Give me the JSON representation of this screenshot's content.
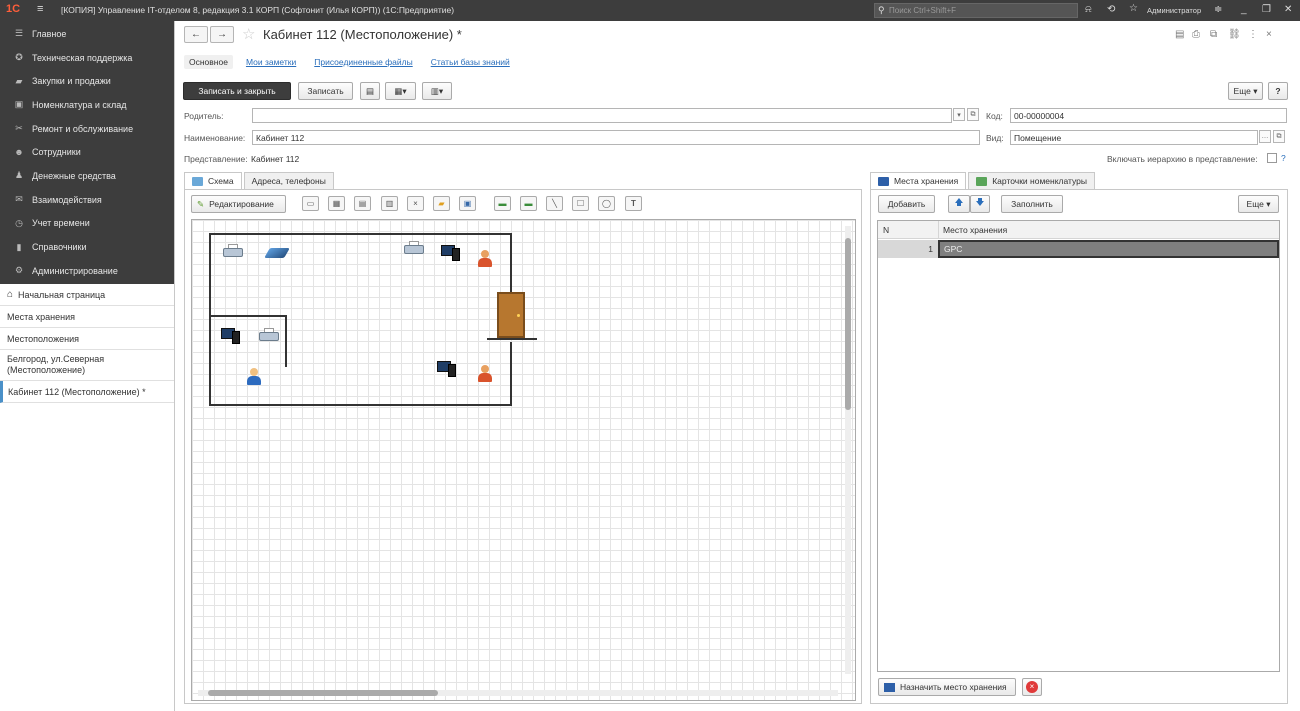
{
  "titlebar": {
    "logo": "1С",
    "title": "[КОПИЯ] Управление IT-отделом 8, редакция 3.1 КОРП (Софтонит (Илья КОРП))  (1С:Предприятие)",
    "search_placeholder": "Поиск Ctrl+Shift+F",
    "user": "Администратор"
  },
  "sidebar": {
    "sections": [
      {
        "label": "Главное",
        "icon": "☰"
      },
      {
        "label": "Техническая поддержка",
        "icon": "✪"
      },
      {
        "label": "Закупки и продажи",
        "icon": "▰"
      },
      {
        "label": "Номенклатура и склад",
        "icon": "▣"
      },
      {
        "label": "Ремонт и обслуживание",
        "icon": "✂"
      },
      {
        "label": "Сотрудники",
        "icon": "☻"
      },
      {
        "label": "Денежные средства",
        "icon": "♟"
      },
      {
        "label": "Взаимодействия",
        "icon": "✉"
      },
      {
        "label": "Учет времени",
        "icon": "◷"
      },
      {
        "label": "Справочники",
        "icon": "▮"
      },
      {
        "label": "Администрирование",
        "icon": "⚙"
      }
    ],
    "nav": {
      "home": "Начальная страница",
      "storage": "Места хранения",
      "locations": "Местоположения",
      "belgorod_line1": "Белгород, ул.Северная",
      "belgorod_line2": "(Местоположение)",
      "current": "Кабинет 112 (Местоположение) *"
    }
  },
  "form": {
    "title": "Кабинет 112 (Местоположение) *",
    "tabs": [
      "Основное",
      "Мои заметки",
      "Присоединенные файлы",
      "Статьи базы знаний"
    ],
    "buttons": {
      "save_close": "Записать и закрыть",
      "save": "Записать",
      "more": "Еще ▾",
      "help": "?"
    },
    "fields": {
      "parent_label": "Родитель:",
      "parent_value": "",
      "code_label": "Код:",
      "code_value": "00-00000004",
      "name_label": "Наименование:",
      "name_value": "Кабинет 112",
      "kind_label": "Вид:",
      "kind_value": "Помещение",
      "repr_label": "Представление:",
      "repr_value": "Кабинет 112",
      "hierarchy_label": "Включать иерархию в представление:",
      "hierarchy_help": "?"
    },
    "left_tabs": [
      "Схема",
      "Адреса, телефоны"
    ],
    "edit_button": "Редактирование",
    "right_tabs": [
      "Места хранения",
      "Карточки номенклатуры"
    ],
    "right_buttons": {
      "add": "Добавить",
      "fill": "Заполнить",
      "more": "Еще ▾",
      "assign": "Назначить место хранения"
    },
    "grid": {
      "columns": [
        "N",
        "Место хранения"
      ],
      "rows": [
        {
          "n": "1",
          "place": "GPC"
        }
      ]
    }
  }
}
